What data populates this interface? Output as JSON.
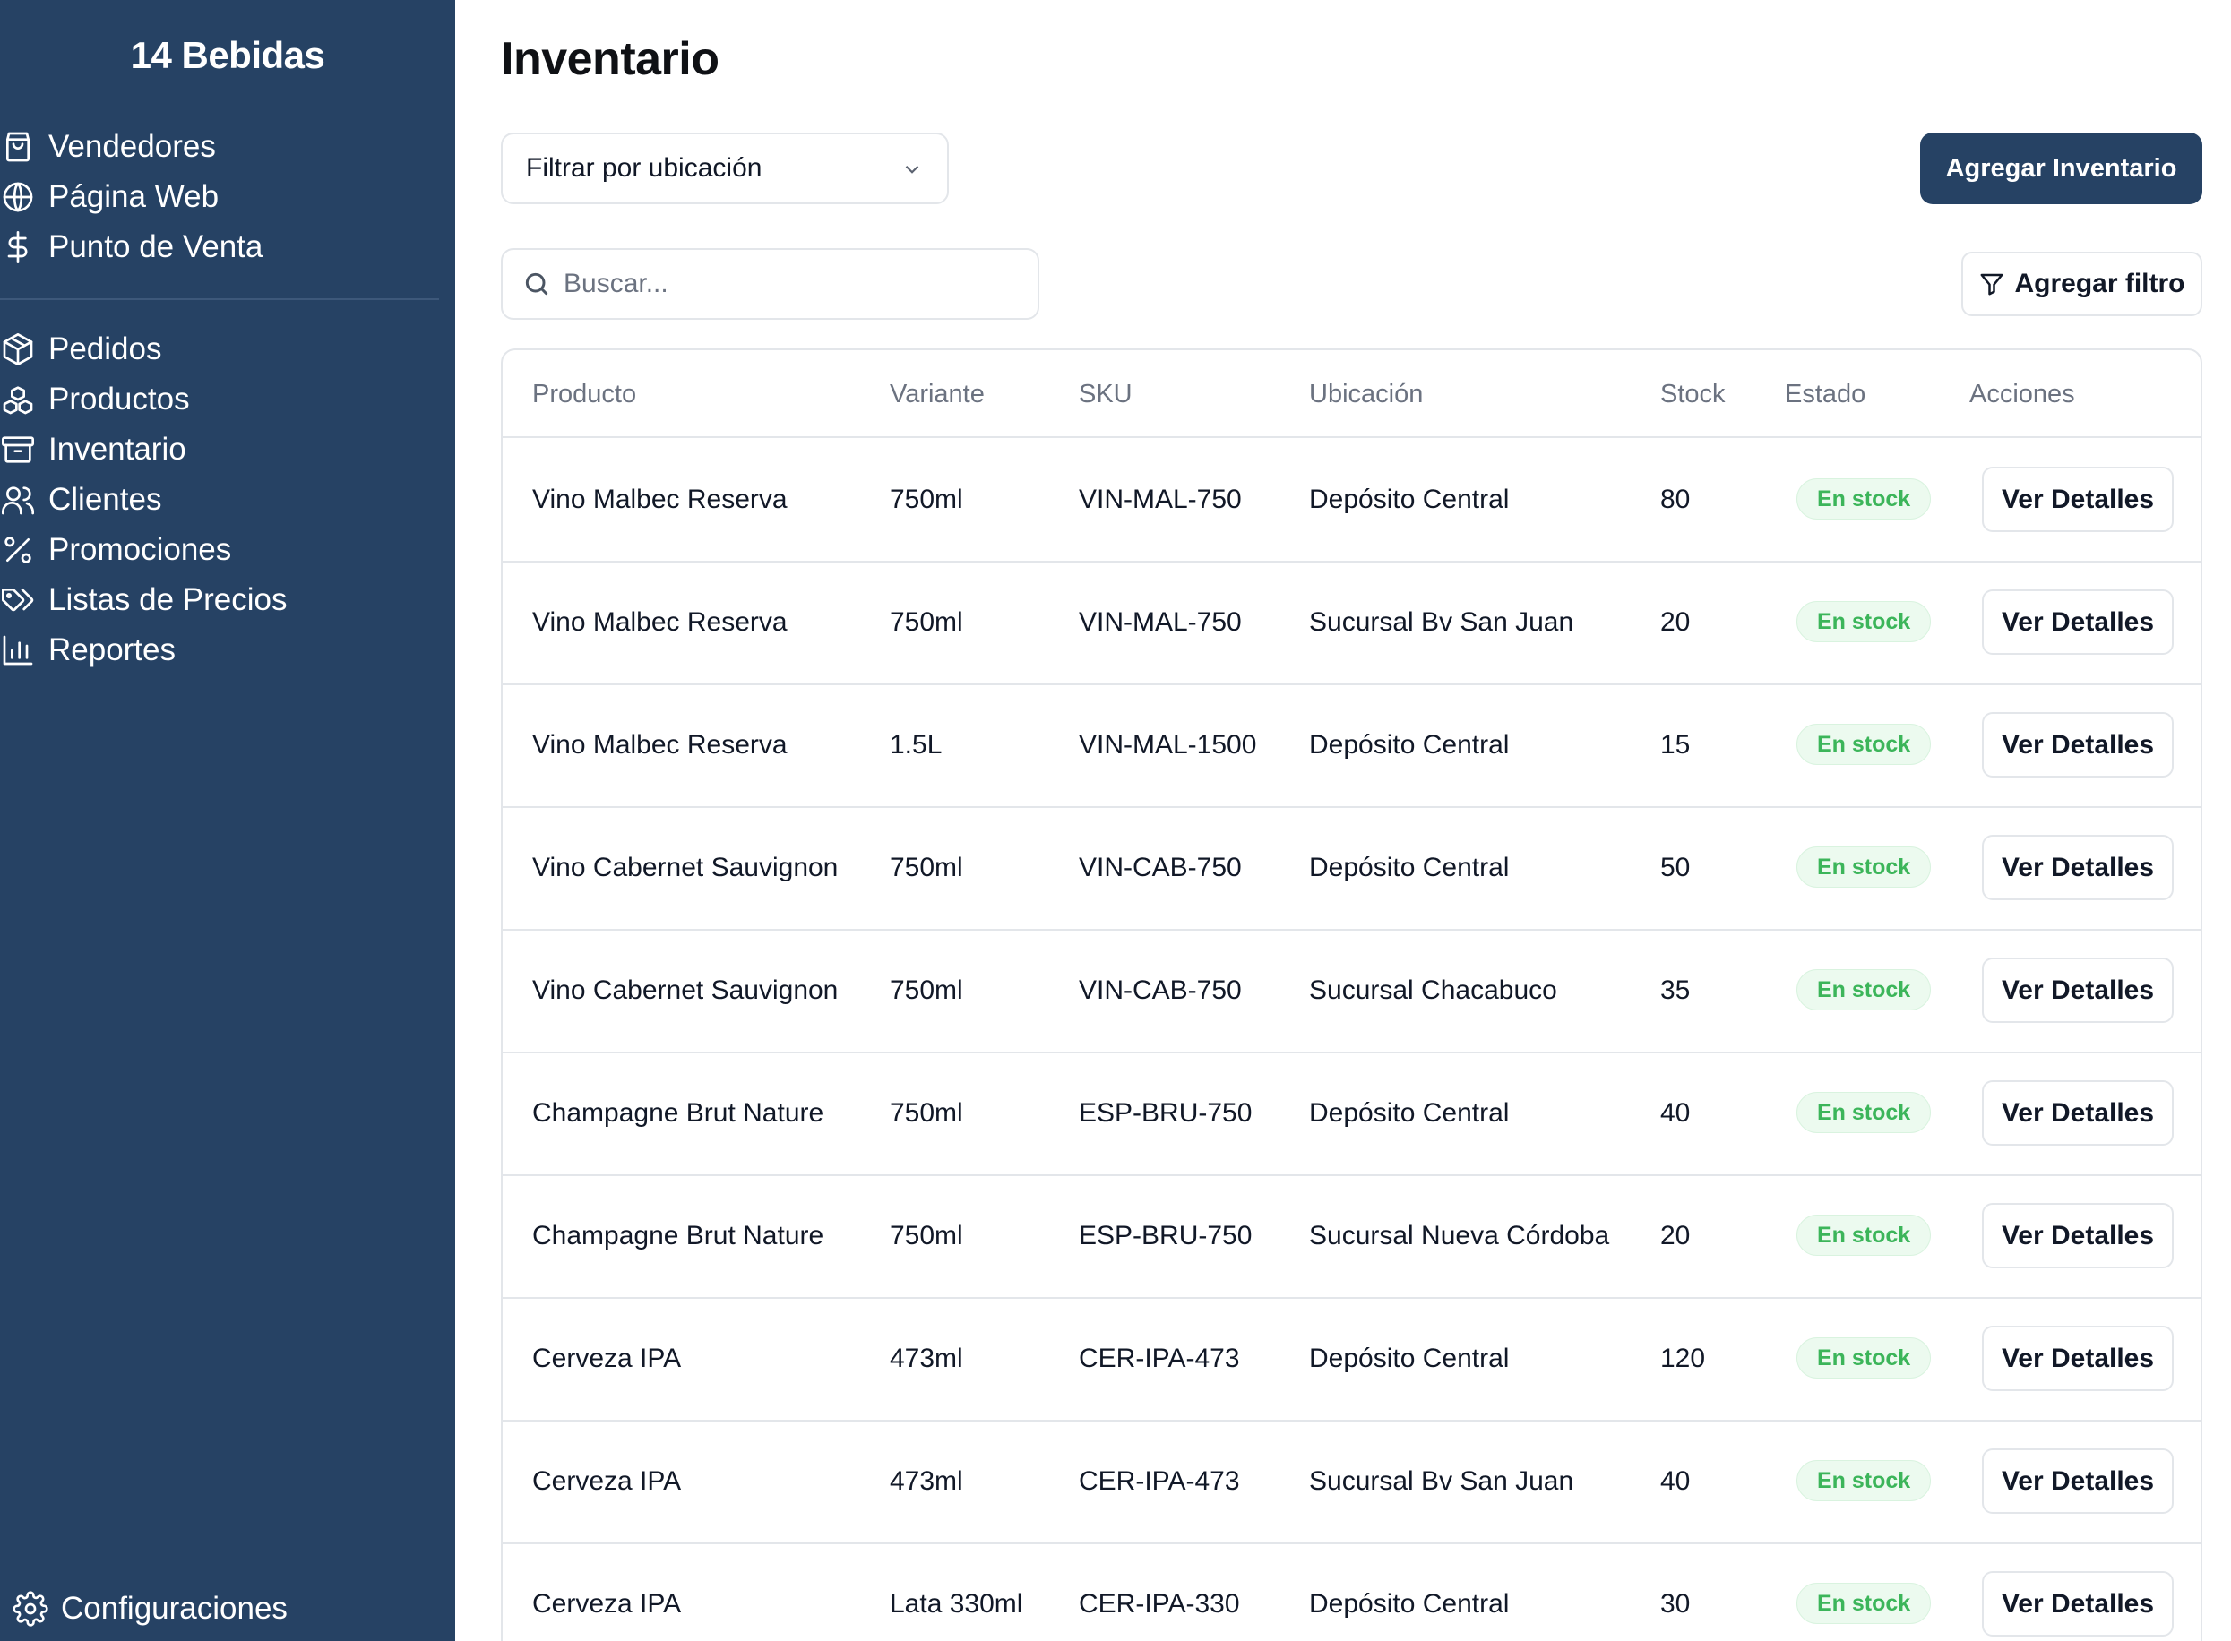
{
  "sidebar": {
    "brand": "14 Bebidas",
    "group1": [
      {
        "label": "Vendedores",
        "icon": "shopping-bag-icon"
      },
      {
        "label": "Página Web",
        "icon": "globe-icon"
      },
      {
        "label": "Punto de Venta",
        "icon": "dollar-icon"
      }
    ],
    "group2": [
      {
        "label": "Pedidos",
        "icon": "package-icon"
      },
      {
        "label": "Productos",
        "icon": "boxes-icon"
      },
      {
        "label": "Inventario",
        "icon": "archive-icon"
      },
      {
        "label": "Clientes",
        "icon": "users-icon"
      },
      {
        "label": "Promociones",
        "icon": "percent-icon"
      },
      {
        "label": "Listas de Precios",
        "icon": "tags-icon"
      },
      {
        "label": "Reportes",
        "icon": "bar-chart-icon"
      }
    ],
    "settings": {
      "label": "Configuraciones",
      "icon": "gear-icon"
    }
  },
  "main": {
    "title": "Inventario",
    "location_filter": {
      "label": "Filtrar por ubicación"
    },
    "add_inventory": "Agregar Inventario",
    "search": {
      "placeholder": "Buscar..."
    },
    "add_filter": "Agregar filtro"
  },
  "table": {
    "headers": {
      "product": "Producto",
      "variant": "Variante",
      "sku": "SKU",
      "location": "Ubicación",
      "stock": "Stock",
      "status": "Estado",
      "actions": "Acciones"
    },
    "details_label": "Ver Detalles",
    "status_color": "#3cb55a",
    "rows": [
      {
        "product": "Vino Malbec Reserva",
        "variant": "750ml",
        "sku": "VIN-MAL-750",
        "location": "Depósito Central",
        "stock": "80",
        "status": "En stock"
      },
      {
        "product": "Vino Malbec Reserva",
        "variant": "750ml",
        "sku": "VIN-MAL-750",
        "location": "Sucursal Bv San Juan",
        "stock": "20",
        "status": "En stock"
      },
      {
        "product": "Vino Malbec Reserva",
        "variant": "1.5L",
        "sku": "VIN-MAL-1500",
        "location": "Depósito Central",
        "stock": "15",
        "status": "En stock"
      },
      {
        "product": "Vino Cabernet Sauvignon",
        "variant": "750ml",
        "sku": "VIN-CAB-750",
        "location": "Depósito Central",
        "stock": "50",
        "status": "En stock"
      },
      {
        "product": "Vino Cabernet Sauvignon",
        "variant": "750ml",
        "sku": "VIN-CAB-750",
        "location": "Sucursal Chacabuco",
        "stock": "35",
        "status": "En stock"
      },
      {
        "product": "Champagne Brut Nature",
        "variant": "750ml",
        "sku": "ESP-BRU-750",
        "location": "Depósito Central",
        "stock": "40",
        "status": "En stock"
      },
      {
        "product": "Champagne Brut Nature",
        "variant": "750ml",
        "sku": "ESP-BRU-750",
        "location": "Sucursal Nueva Córdoba",
        "stock": "20",
        "status": "En stock"
      },
      {
        "product": "Cerveza IPA",
        "variant": "473ml",
        "sku": "CER-IPA-473",
        "location": "Depósito Central",
        "stock": "120",
        "status": "En stock"
      },
      {
        "product": "Cerveza IPA",
        "variant": "473ml",
        "sku": "CER-IPA-473",
        "location": "Sucursal Bv San Juan",
        "stock": "40",
        "status": "En stock"
      },
      {
        "product": "Cerveza IPA",
        "variant": "Lata 330ml",
        "sku": "CER-IPA-330",
        "location": "Depósito Central",
        "stock": "30",
        "status": "En stock"
      }
    ]
  }
}
